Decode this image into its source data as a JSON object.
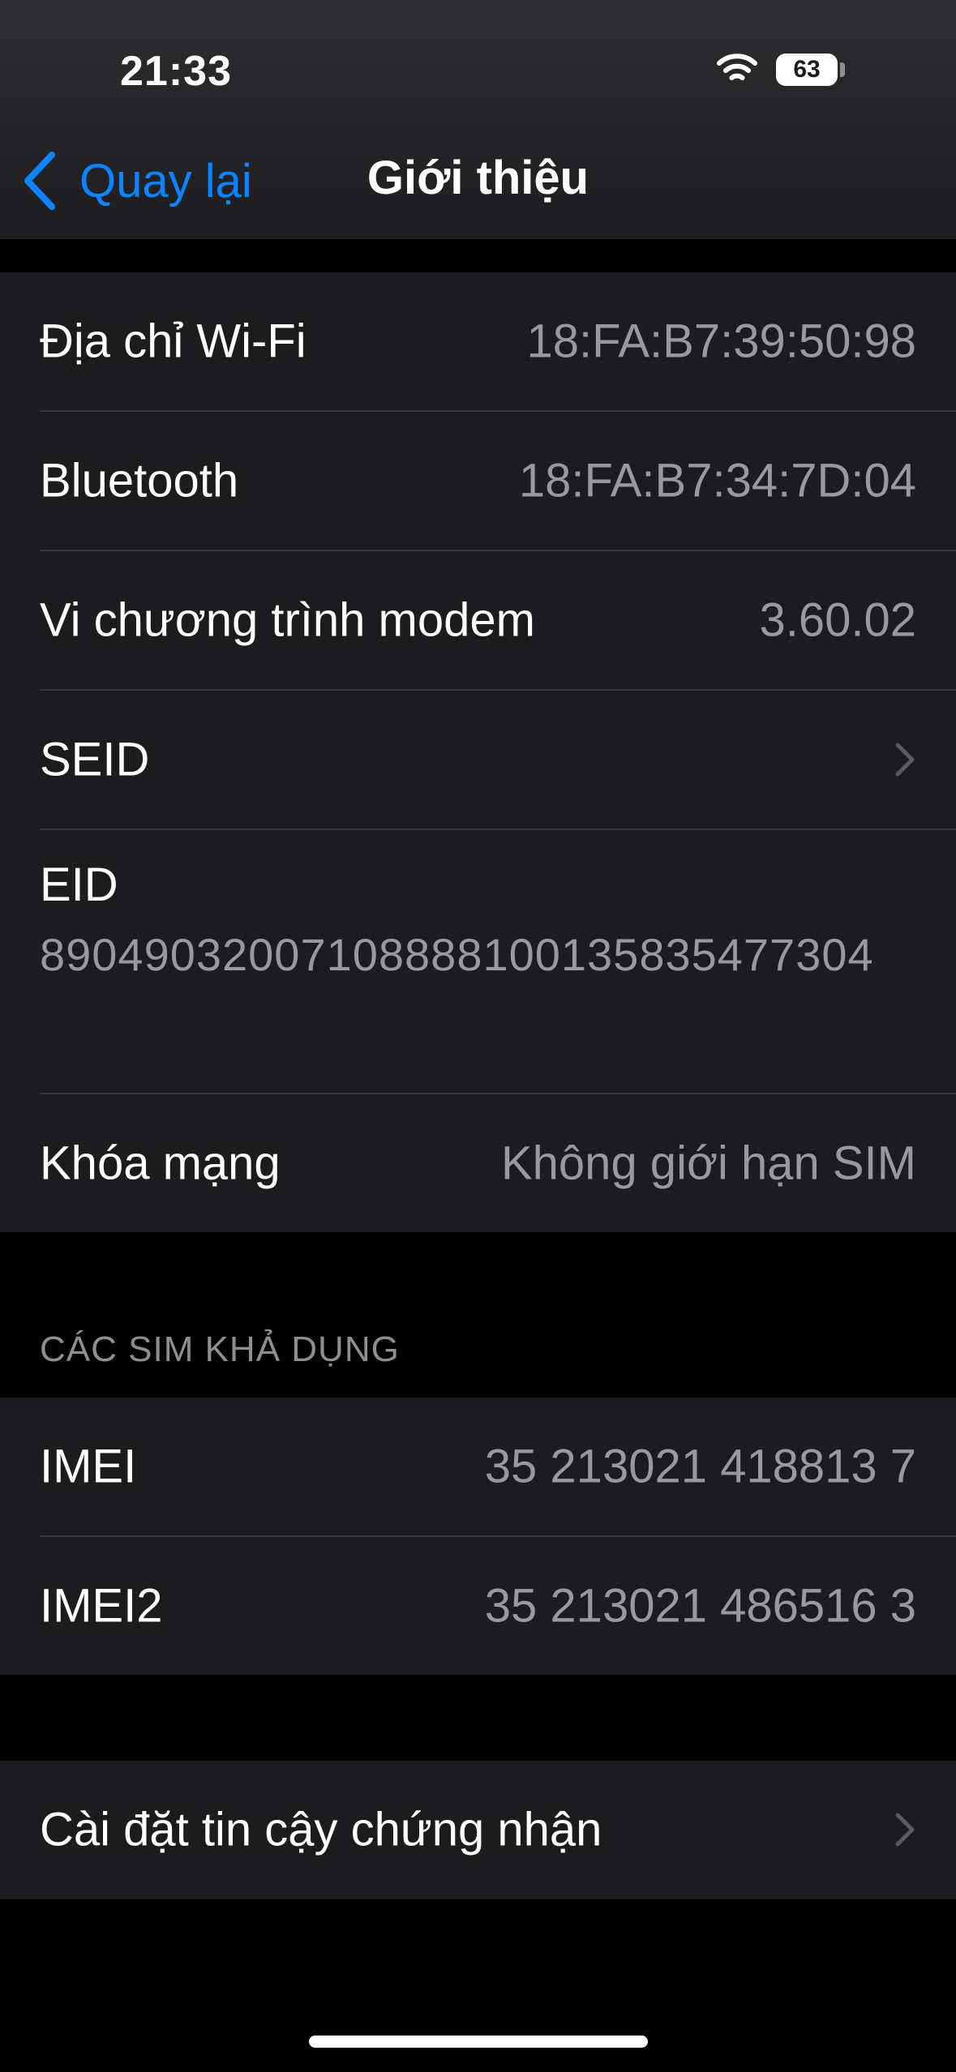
{
  "status_bar": {
    "time": "21:33",
    "battery": "63"
  },
  "nav": {
    "back_label": "Quay lại",
    "title": "Giới thiệu"
  },
  "group1": {
    "rows": [
      {
        "label": "Địa chỉ Wi-Fi",
        "value": "18:FA:B7:39:50:98"
      },
      {
        "label": "Bluetooth",
        "value": "18:FA:B7:34:7D:04"
      },
      {
        "label": "Vi chương trình modem",
        "value": "3.60.02"
      },
      {
        "label": "SEID"
      }
    ],
    "eid": {
      "label": "EID",
      "value": "89049032007108888100135835477304"
    },
    "network_lock": {
      "label": "Khóa mạng",
      "value": "Không giới hạn SIM"
    }
  },
  "sim_section": {
    "header": "CÁC SIM KHẢ DỤNG",
    "rows": [
      {
        "label": "IMEI",
        "value": "35 213021 418813 7"
      },
      {
        "label": "IMEI2",
        "value": "35 213021 486516 3"
      }
    ]
  },
  "certificate": {
    "label": "Cài đặt tin cậy chứng nhận"
  },
  "colors": {
    "accent": "#0a84ff",
    "background": "#000000",
    "group_background": "#1c1c1e",
    "secondary_text": "#98989f"
  }
}
